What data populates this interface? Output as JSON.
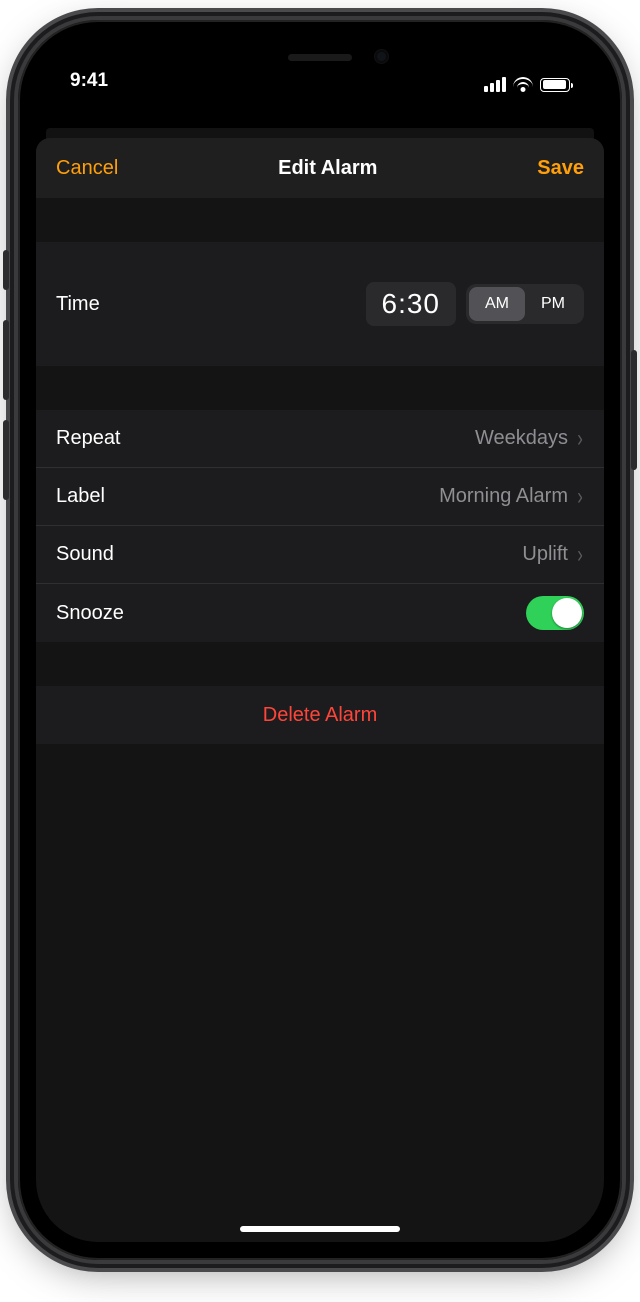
{
  "statusbar": {
    "time": "9:41"
  },
  "navbar": {
    "cancel": "Cancel",
    "title": "Edit Alarm",
    "save": "Save"
  },
  "time": {
    "label": "Time",
    "value": "6:30",
    "am": "AM",
    "pm": "PM",
    "active": "AM"
  },
  "rows": {
    "repeat": {
      "label": "Repeat",
      "value": "Weekdays"
    },
    "alarm_label": {
      "label": "Label",
      "value": "Morning Alarm"
    },
    "sound": {
      "label": "Sound",
      "value": "Uplift"
    },
    "snooze": {
      "label": "Snooze",
      "on": true
    }
  },
  "delete": {
    "label": "Delete Alarm"
  },
  "colors": {
    "accent": "#ff9f0a",
    "destructive": "#ff453a",
    "switch_on": "#30d158",
    "bg": "#000000",
    "cell": "#1c1c1e",
    "secondary_text": "#8e8e93"
  }
}
